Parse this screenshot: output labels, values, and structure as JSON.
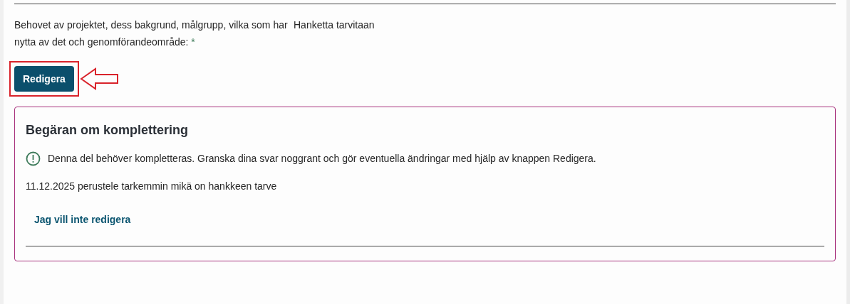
{
  "question": {
    "label": "Behovet av projektet, dess bakgrund, målgrupp, vilka som har nytta av det och genomförandeområde:",
    "required_mark": "*",
    "answer": "Hanketta tarvitaan"
  },
  "edit_button": {
    "label": "Redigera",
    "highlighted": true
  },
  "callout": {
    "title": "Begäran om komplettering",
    "notice": "Denna del behöver kompletteras. Granska dina svar noggrant och gör eventuella ändringar med hjälp av knappen Redigera.",
    "comment": "11.12.2025 perustele tarkemmin mikä on hankkeen tarve",
    "link": "Jag vill inte redigera"
  }
}
